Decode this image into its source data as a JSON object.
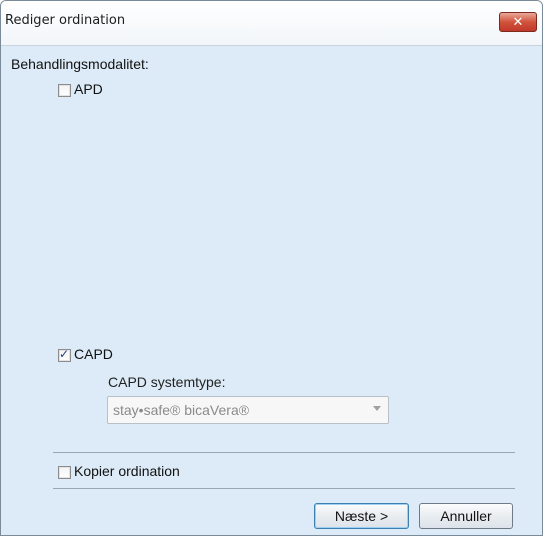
{
  "window": {
    "title": "Rediger ordination",
    "close_glyph": "✕"
  },
  "form": {
    "modality_label": "Behandlingsmodalitet:",
    "options": [
      {
        "label": "APD",
        "checked": false
      },
      {
        "label": "CAPD",
        "checked": true
      }
    ],
    "capd_system_label": "CAPD systemtype:",
    "capd_system_value": "stay•safe® bicaVera®",
    "copy_ordination_label": "Kopier ordination",
    "copy_ordination_checked": false
  },
  "buttons": {
    "next_label": "Næste >",
    "cancel_label": "Annuller"
  }
}
